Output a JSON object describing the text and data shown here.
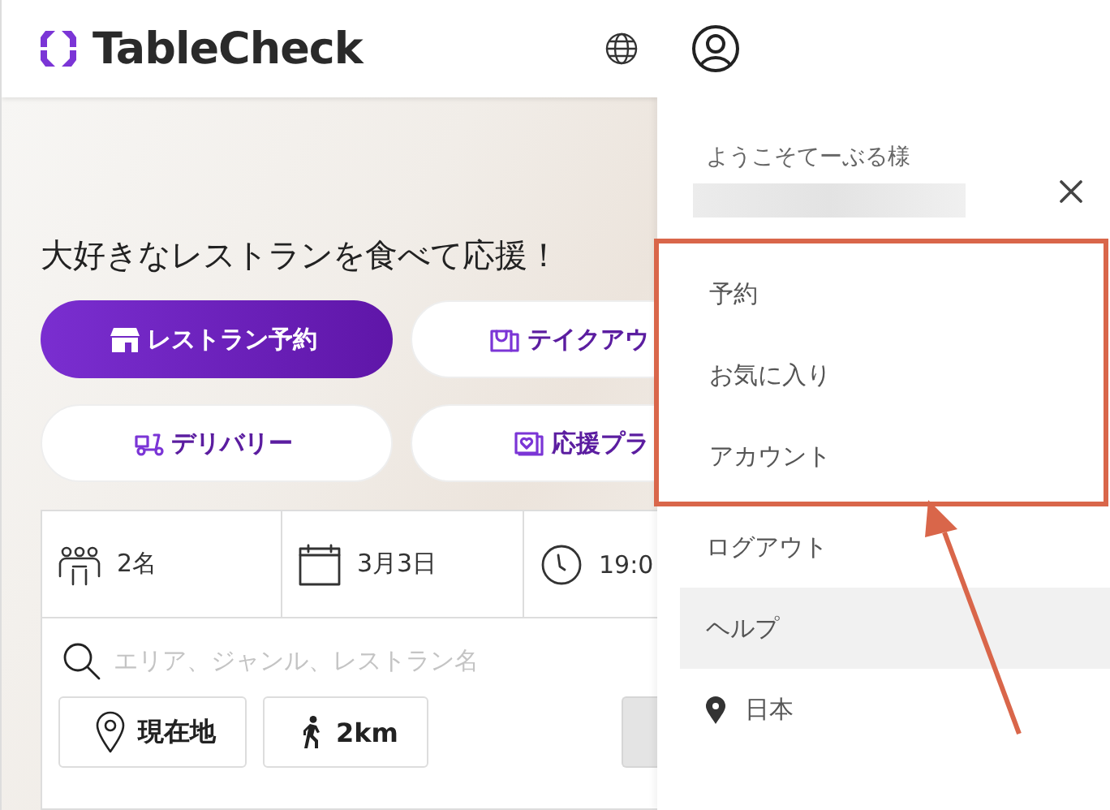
{
  "header": {
    "logo": "TableCheck"
  },
  "hero": {
    "heading": "大好きなレストランを食べて応援！",
    "services": [
      {
        "label": "レストラン予約",
        "kind": "store",
        "selected": true
      },
      {
        "label": "テイクアウ",
        "kind": "takeout",
        "selected": false
      },
      {
        "label": "デリバリー",
        "kind": "delivery",
        "selected": false
      },
      {
        "label": "応援プラ",
        "kind": "support",
        "selected": false
      }
    ]
  },
  "search": {
    "fields": [
      {
        "kind": "people",
        "value": "2名"
      },
      {
        "kind": "date",
        "value": "3月3日"
      },
      {
        "kind": "time",
        "value": "19:0"
      }
    ],
    "placeholder": "エリア、ジャンル、レストラン名",
    "chips": [
      {
        "kind": "location",
        "label": "現在地"
      },
      {
        "kind": "distance",
        "label": "2km"
      }
    ]
  },
  "drawer": {
    "welcome": "ようこそてーぶる様",
    "highlighted_items": [
      {
        "label": "予約",
        "hovered": false
      },
      {
        "label": "お気に入り",
        "hovered": false
      },
      {
        "label": "アカウント",
        "hovered": false
      }
    ],
    "items": [
      {
        "label": "ログアウト",
        "hovered": false
      },
      {
        "label": "ヘルプ",
        "hovered": true
      }
    ],
    "region": "日本"
  }
}
